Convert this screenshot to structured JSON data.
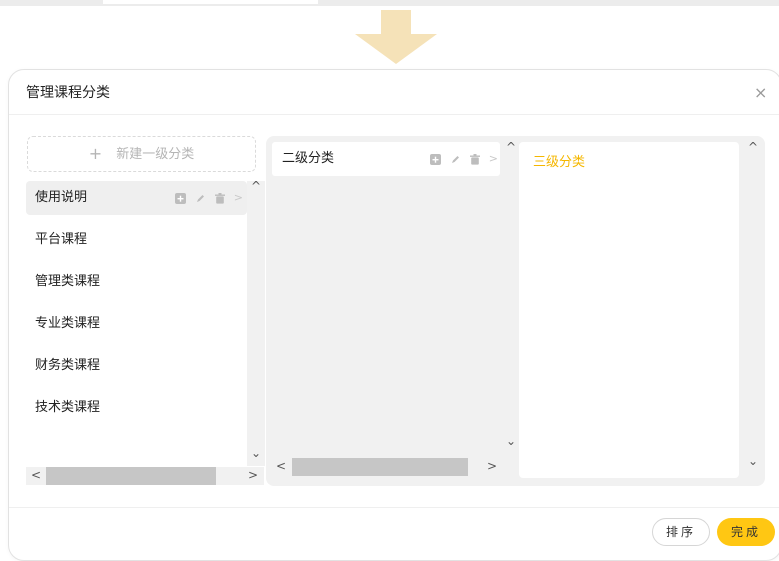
{
  "modal": {
    "title": "管理课程分类",
    "close_symbol": "×"
  },
  "level1": {
    "new_button_label": "新建一级分类",
    "items": [
      {
        "label": "使用说明",
        "selected": true
      },
      {
        "label": "平台课程"
      },
      {
        "label": "管理类课程"
      },
      {
        "label": "专业类课程"
      },
      {
        "label": "财务类课程"
      },
      {
        "label": "技术类课程"
      }
    ]
  },
  "level2": {
    "items": [
      {
        "label": "二级分类"
      }
    ]
  },
  "level3": {
    "label": "三级分类"
  },
  "icons": {
    "add": "add-square-icon",
    "edit": "pencil-icon",
    "delete": "trash-icon",
    "expand": "chevron-right-icon"
  },
  "scroll_arrows": {
    "up": "^",
    "down": "⌄",
    "left": "<",
    "right": ">",
    "expand": ">"
  },
  "footer": {
    "sort_label": "排序",
    "done_label": "完成"
  },
  "colors": {
    "accent": "#ffc713",
    "level3_text": "#f5b700",
    "arrow": "#f5e2b8"
  }
}
